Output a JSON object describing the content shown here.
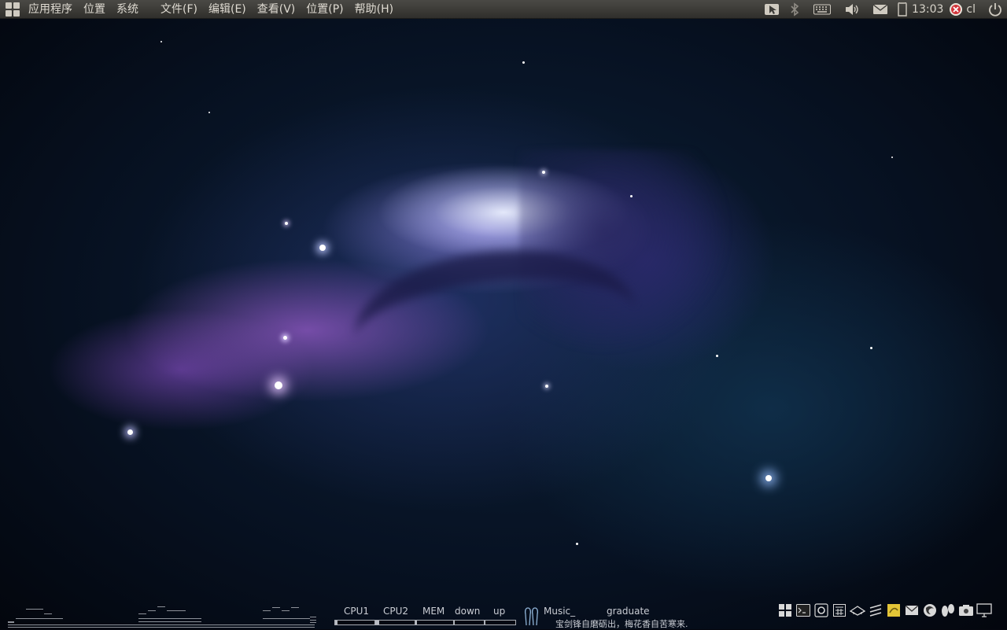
{
  "top_panel": {
    "menus": [
      "应用程序",
      "位置",
      "系统"
    ],
    "app_menus": [
      "文件(F)",
      "编辑(E)",
      "查看(V)",
      "位置(P)",
      "帮助(H)"
    ],
    "clock": "13:03",
    "user": "cl"
  },
  "conky": {
    "cpu1_label": "CPU1",
    "cpu2_label": "CPU2",
    "mem_label": "MEM",
    "down_label": "down",
    "up_label": "up",
    "music_label": "Music_",
    "track_title": "graduate",
    "quote": "宝剑锋自磨砺出，梅花香自苦寒来."
  },
  "dock": {
    "icons": [
      "show-desktop-icon",
      "terminal-icon",
      "settings-icon",
      "calculator-icon",
      "hat-icon",
      "network-icon",
      "notes-icon",
      "mail-icon",
      "firefox-icon",
      "people-icon",
      "camera-icon",
      "monitor-icon"
    ]
  },
  "colors": {
    "panel_bg": "#3c3b37",
    "panel_text": "#dfdbd2",
    "conky_text": "#c9ccd3"
  }
}
